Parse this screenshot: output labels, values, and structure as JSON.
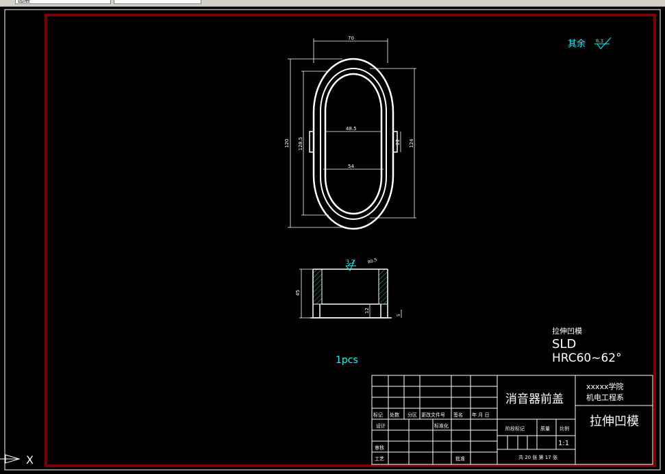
{
  "toolbar": {
    "layer_field": "图层",
    "style_field": ""
  },
  "roughness_note": {
    "label": "其余",
    "value": "6.3"
  },
  "top_view_dims": {
    "width": "70",
    "height": "120",
    "inner_height": "128.5",
    "right_height": "124",
    "inner_width": "48.5",
    "lower_width": "54",
    "slot": "22"
  },
  "section_view_dims": {
    "roughness": "3.2",
    "chamfer": "R0.5",
    "height": "45",
    "step": "12",
    "base": "5"
  },
  "material": {
    "part": "拉伸凹模",
    "steel": "SLD",
    "hardness": "HRC60~62°"
  },
  "quantity": "1pcs",
  "title_block": {
    "product": "消音器前盖",
    "school": "xxxxx学院",
    "department": "机电工程系",
    "drawing_name": "拉伸凹模",
    "headers": [
      "标记",
      "处数",
      "分区",
      "更改文件号",
      "签名",
      "年 月 日"
    ],
    "row_design": "设计",
    "row_std": "标准化",
    "row_review": "审核",
    "row_process": "工艺",
    "row_approve": "批准",
    "stage_mark": "阶段标记",
    "mass": "质量",
    "scale_label": "比例",
    "scale": "1:1",
    "sheet_info": "共 20 张 第 17 张"
  },
  "ucs": {
    "x_label": "X"
  },
  "colors": {
    "frame": "#7a0000",
    "line": "#ffffff",
    "cyan": "#00ffff",
    "hatch": "#2fb0a8"
  }
}
